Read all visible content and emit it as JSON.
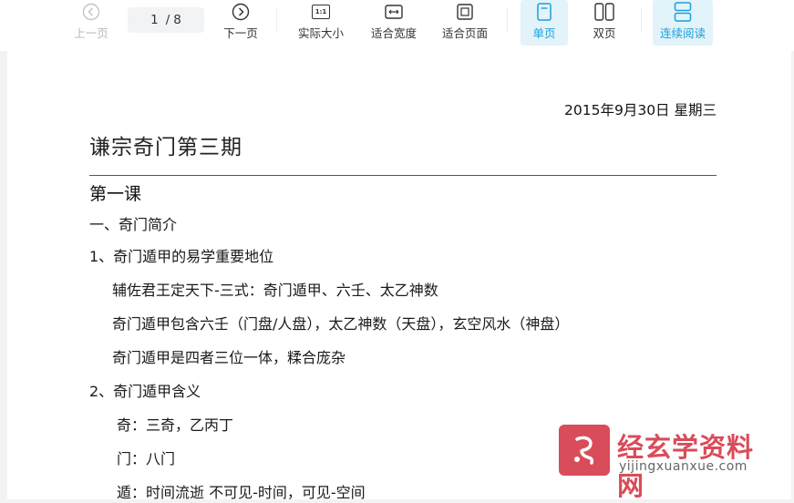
{
  "toolbar": {
    "prev_label": "上一页",
    "page_current": "1",
    "page_total": "8",
    "next_label": "下一页",
    "actual_size_label": "实际大小",
    "actual_size_icon_text": "1:1",
    "fit_width_label": "适合宽度",
    "fit_page_label": "适合页面",
    "single_page_label": "单页",
    "double_page_label": "双页",
    "continuous_label": "连续阅读",
    "accent_color": "#1aa0d8",
    "active_bg": "#e3f3fa"
  },
  "document": {
    "date": "2015年9月30日 星期三",
    "title": "谦宗奇门第三期",
    "lesson": "第一课",
    "section1": "一、奇门简介",
    "item1": "1、奇门遁甲的易学重要地位",
    "item1_lines": [
      "辅佐君王定天下-三式：奇门遁甲、六壬、太乙神数",
      "奇门遁甲包含六壬（门盘/人盘），太乙神数（天盘），玄空风水（神盘）",
      "奇门遁甲是四者三位一体，糅合庞杂"
    ],
    "item2": "2、奇门遁甲含义",
    "item2_lines": [
      "奇：三奇，乙丙丁",
      "门：八门",
      "遁：时间流逝  不可见-时间，可见-空间"
    ]
  },
  "watermark": {
    "name": "经玄学资料网",
    "url": "yijingxuanxue.com",
    "color": "#d94c5a"
  }
}
